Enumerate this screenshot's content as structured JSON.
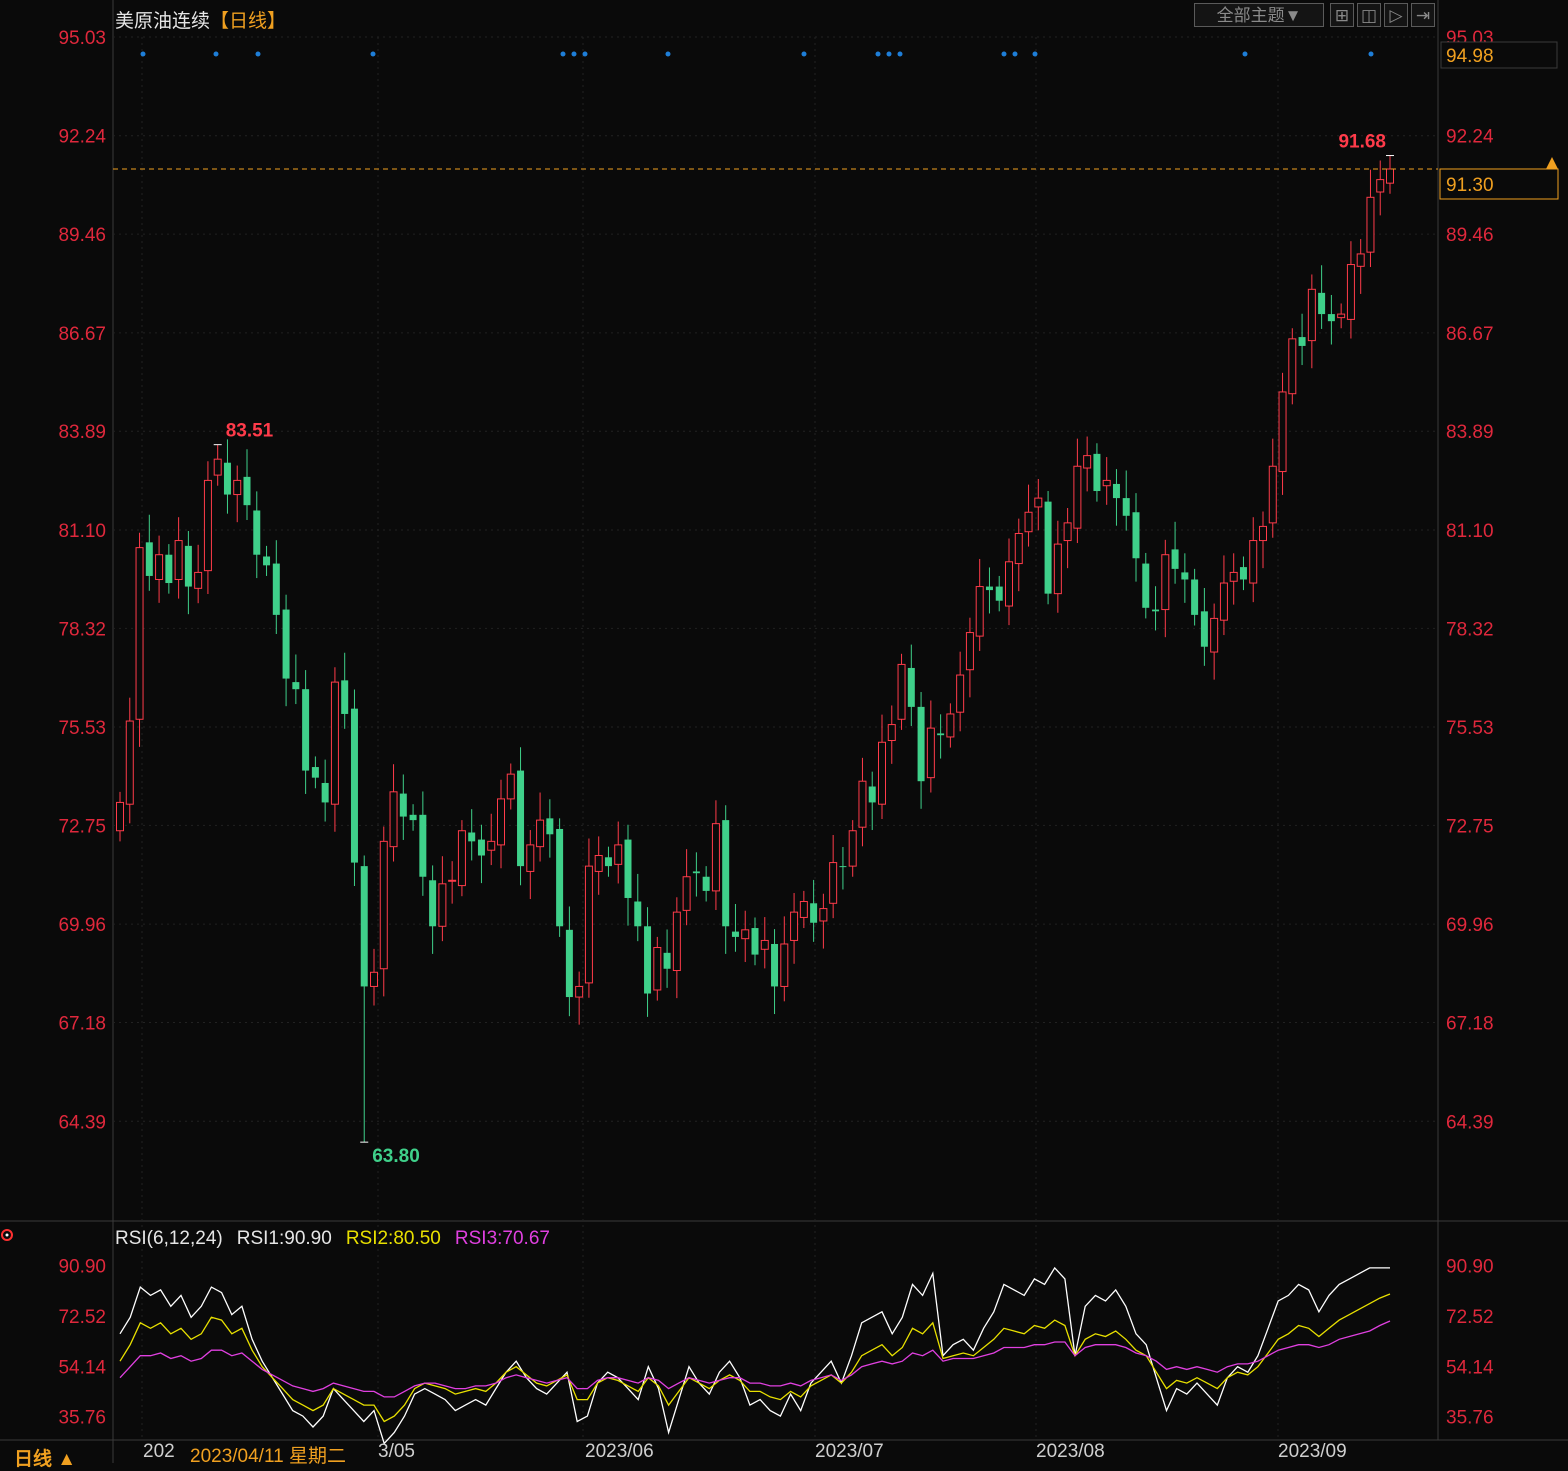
{
  "header": {
    "instrument": "美原油连续",
    "period": "【日线】",
    "theme_button": "全部主题▼"
  },
  "price_panel": {
    "left_ticks": [
      "95.03",
      "92.24",
      "89.46",
      "86.67",
      "83.89",
      "81.10",
      "78.32",
      "75.53",
      "72.75",
      "69.96",
      "67.18",
      "64.39"
    ],
    "right_ticks": [
      "95.03",
      "92.24",
      "89.46",
      "86.67",
      "83.89",
      "81.10",
      "78.32",
      "75.53",
      "72.75",
      "69.96",
      "67.18",
      "64.39"
    ],
    "top_value_box": "94.98",
    "last_price_box": "91.30",
    "annotations": {
      "high": "91.68",
      "mid_high": "83.51",
      "low": "63.80"
    },
    "colors": {
      "up": "#ff3b4a",
      "down": "#3fd08a",
      "axis_text": "#e0283c",
      "last_line": "#f0a020",
      "signal_dot": "#1e7ed8"
    }
  },
  "rsi_panel": {
    "title": "RSI(6,12,24)",
    "rsi1_label": "RSI1:90.90",
    "rsi2_label": "RSI2:80.50",
    "rsi3_label": "RSI3:70.67",
    "left_ticks": [
      "90.90",
      "72.52",
      "54.14",
      "35.76"
    ],
    "right_ticks": [
      "90.90",
      "72.52",
      "54.14",
      "35.76"
    ],
    "colors": {
      "rsi1": "#ffffff",
      "rsi2": "#e8e000",
      "rsi3": "#e040e0"
    }
  },
  "footer": {
    "period_label": "日线 ▲",
    "cursor_date": "2023/04/11 星期二",
    "x_ticks": [
      "202",
      "3/05",
      "2023/06",
      "2023/07",
      "2023/08",
      "2023/09"
    ]
  },
  "chart_data": [
    {
      "type": "candlestick",
      "title": "美原油连续【日线】",
      "ylim": [
        61.6,
        95.03
      ],
      "x_ticks": [
        "2023/05",
        "2023/06",
        "2023/07",
        "2023/08",
        "2023/09"
      ],
      "closes": [
        73.4,
        75.7,
        80.6,
        79.8,
        80.4,
        79.6,
        80.8,
        79.5,
        79.9,
        82.5,
        83.1,
        82.1,
        82.5,
        81.8,
        80.4,
        80.1,
        78.7,
        76.9,
        76.6,
        74.3,
        74.1,
        73.4,
        76.8,
        75.9,
        71.7,
        68.2,
        68.6,
        72.3,
        73.7,
        73.0,
        72.9,
        71.3,
        69.9,
        71.1,
        71.2,
        72.6,
        72.3,
        71.9,
        72.3,
        73.5,
        74.2,
        71.6,
        72.2,
        72.9,
        72.5,
        69.9,
        67.9,
        68.2,
        71.6,
        71.9,
        71.6,
        72.2,
        70.7,
        69.9,
        68.0,
        69.3,
        68.7,
        70.3,
        71.3,
        71.4,
        70.9,
        72.8,
        69.9,
        69.6,
        69.8,
        69.1,
        69.5,
        68.2,
        69.4,
        70.3,
        70.6,
        70.0,
        70.4,
        71.7,
        71.6,
        72.6,
        74.0,
        73.4,
        75.1,
        75.6,
        77.3,
        76.1,
        74.0,
        75.5,
        75.3,
        75.9,
        77.0,
        78.2,
        79.5,
        79.4,
        79.1,
        80.2,
        81.0,
        81.6,
        82.0,
        79.3,
        80.7,
        81.3,
        82.9,
        83.2,
        82.2,
        82.5,
        82.0,
        81.5,
        80.3,
        78.9,
        78.8,
        80.4,
        80.0,
        79.7,
        78.7,
        77.8,
        78.6,
        79.6,
        79.9,
        79.7,
        80.8,
        81.2,
        82.9,
        85.0,
        86.5,
        86.3,
        87.9,
        87.2,
        87.0,
        87.2,
        88.6,
        88.9,
        90.5,
        91.0,
        91.3
      ],
      "annotations": {
        "high": 91.68,
        "high_83": 83.51,
        "low": 63.8
      },
      "last": 91.3
    },
    {
      "type": "line",
      "title": "RSI(6,12,24)",
      "ylim": [
        28,
        98
      ],
      "series": [
        {
          "name": "RSI1",
          "values": [
            66,
            72,
            83,
            80,
            82,
            76,
            80,
            72,
            76,
            83,
            81,
            73,
            76,
            64,
            56,
            50,
            44,
            38,
            36,
            32,
            36,
            46,
            42,
            38,
            34,
            38,
            26,
            30,
            36,
            44,
            46,
            44,
            42,
            38,
            40,
            42,
            40,
            46,
            52,
            56,
            50,
            46,
            44,
            48,
            52,
            34,
            36,
            48,
            52,
            50,
            46,
            42,
            54,
            46,
            30,
            42,
            54,
            48,
            44,
            52,
            56,
            50,
            40,
            42,
            38,
            36,
            44,
            38,
            48,
            52,
            56,
            48,
            58,
            70,
            72,
            74,
            66,
            72,
            84,
            80,
            88,
            58,
            62,
            64,
            60,
            68,
            74,
            84,
            82,
            80,
            86,
            84,
            90,
            86,
            58,
            76,
            80,
            78,
            82,
            76,
            66,
            62,
            50,
            38,
            46,
            44,
            48,
            44,
            40,
            50,
            54,
            52,
            58,
            68,
            78,
            80,
            84,
            82,
            74,
            80,
            84,
            86,
            88,
            90,
            90,
            90
          ]
        },
        {
          "name": "RSI2",
          "values": [
            56,
            62,
            70,
            68,
            70,
            66,
            68,
            64,
            66,
            72,
            71,
            66,
            68,
            60,
            54,
            50,
            46,
            42,
            40,
            38,
            40,
            46,
            44,
            42,
            40,
            40,
            34,
            36,
            40,
            46,
            48,
            47,
            46,
            44,
            45,
            46,
            45,
            48,
            52,
            54,
            51,
            48,
            47,
            49,
            51,
            42,
            42,
            48,
            50,
            49,
            47,
            45,
            50,
            47,
            40,
            45,
            50,
            48,
            46,
            49,
            51,
            49,
            45,
            45,
            43,
            42,
            45,
            43,
            47,
            49,
            51,
            48,
            52,
            58,
            60,
            62,
            58,
            61,
            68,
            66,
            70,
            57,
            58,
            59,
            58,
            61,
            64,
            68,
            67,
            66,
            69,
            68,
            71,
            69,
            58,
            64,
            66,
            65,
            67,
            64,
            60,
            58,
            52,
            46,
            49,
            48,
            50,
            48,
            46,
            50,
            52,
            51,
            54,
            59,
            64,
            66,
            69,
            68,
            65,
            68,
            71,
            73,
            75,
            77,
            79,
            80.5
          ]
        },
        {
          "name": "RSI3",
          "values": [
            50,
            54,
            58,
            58,
            59,
            57,
            58,
            56,
            57,
            60,
            60,
            58,
            59,
            56,
            53,
            51,
            49,
            47,
            46,
            45,
            46,
            48,
            47,
            46,
            45,
            45,
            43,
            43,
            45,
            47,
            48,
            48,
            47,
            46,
            46,
            47,
            47,
            48,
            50,
            51,
            50,
            49,
            48,
            49,
            50,
            46,
            46,
            49,
            50,
            50,
            49,
            48,
            50,
            49,
            46,
            48,
            50,
            49,
            48,
            49,
            50,
            50,
            48,
            48,
            47,
            47,
            48,
            47,
            49,
            50,
            51,
            49,
            51,
            54,
            55,
            56,
            55,
            56,
            59,
            58,
            60,
            56,
            57,
            57,
            57,
            58,
            59,
            61,
            61,
            61,
            62,
            62,
            63,
            63,
            58,
            61,
            62,
            62,
            62,
            61,
            59,
            58,
            56,
            53,
            54,
            53,
            54,
            53,
            52,
            54,
            55,
            55,
            56,
            58,
            60,
            61,
            62,
            62,
            61,
            62,
            64,
            65,
            66,
            67,
            69,
            70.67
          ]
        }
      ]
    }
  ]
}
